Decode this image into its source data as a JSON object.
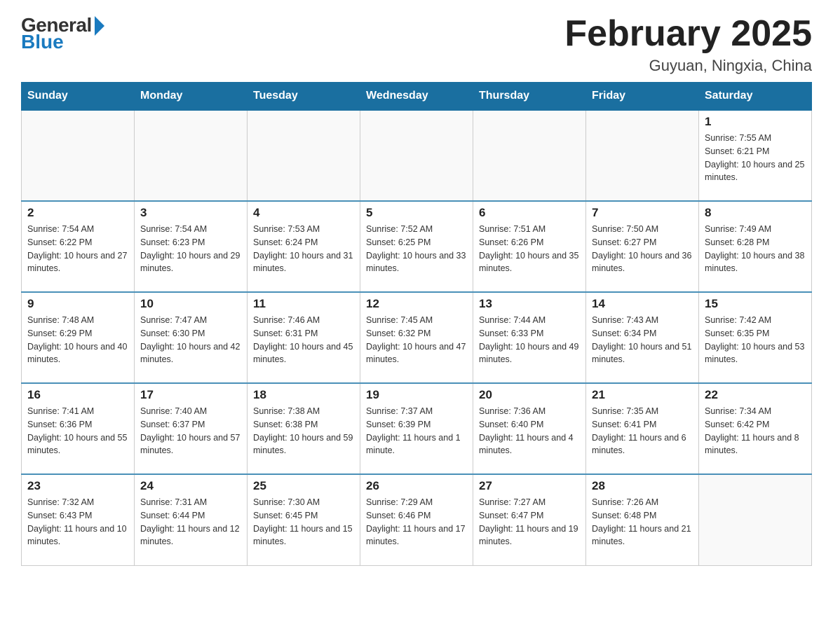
{
  "header": {
    "logo_general": "General",
    "logo_blue": "Blue",
    "month_title": "February 2025",
    "location": "Guyuan, Ningxia, China"
  },
  "weekdays": [
    "Sunday",
    "Monday",
    "Tuesday",
    "Wednesday",
    "Thursday",
    "Friday",
    "Saturday"
  ],
  "weeks": [
    [
      {
        "day": "",
        "sunrise": "",
        "sunset": "",
        "daylight": ""
      },
      {
        "day": "",
        "sunrise": "",
        "sunset": "",
        "daylight": ""
      },
      {
        "day": "",
        "sunrise": "",
        "sunset": "",
        "daylight": ""
      },
      {
        "day": "",
        "sunrise": "",
        "sunset": "",
        "daylight": ""
      },
      {
        "day": "",
        "sunrise": "",
        "sunset": "",
        "daylight": ""
      },
      {
        "day": "",
        "sunrise": "",
        "sunset": "",
        "daylight": ""
      },
      {
        "day": "1",
        "sunrise": "Sunrise: 7:55 AM",
        "sunset": "Sunset: 6:21 PM",
        "daylight": "Daylight: 10 hours and 25 minutes."
      }
    ],
    [
      {
        "day": "2",
        "sunrise": "Sunrise: 7:54 AM",
        "sunset": "Sunset: 6:22 PM",
        "daylight": "Daylight: 10 hours and 27 minutes."
      },
      {
        "day": "3",
        "sunrise": "Sunrise: 7:54 AM",
        "sunset": "Sunset: 6:23 PM",
        "daylight": "Daylight: 10 hours and 29 minutes."
      },
      {
        "day": "4",
        "sunrise": "Sunrise: 7:53 AM",
        "sunset": "Sunset: 6:24 PM",
        "daylight": "Daylight: 10 hours and 31 minutes."
      },
      {
        "day": "5",
        "sunrise": "Sunrise: 7:52 AM",
        "sunset": "Sunset: 6:25 PM",
        "daylight": "Daylight: 10 hours and 33 minutes."
      },
      {
        "day": "6",
        "sunrise": "Sunrise: 7:51 AM",
        "sunset": "Sunset: 6:26 PM",
        "daylight": "Daylight: 10 hours and 35 minutes."
      },
      {
        "day": "7",
        "sunrise": "Sunrise: 7:50 AM",
        "sunset": "Sunset: 6:27 PM",
        "daylight": "Daylight: 10 hours and 36 minutes."
      },
      {
        "day": "8",
        "sunrise": "Sunrise: 7:49 AM",
        "sunset": "Sunset: 6:28 PM",
        "daylight": "Daylight: 10 hours and 38 minutes."
      }
    ],
    [
      {
        "day": "9",
        "sunrise": "Sunrise: 7:48 AM",
        "sunset": "Sunset: 6:29 PM",
        "daylight": "Daylight: 10 hours and 40 minutes."
      },
      {
        "day": "10",
        "sunrise": "Sunrise: 7:47 AM",
        "sunset": "Sunset: 6:30 PM",
        "daylight": "Daylight: 10 hours and 42 minutes."
      },
      {
        "day": "11",
        "sunrise": "Sunrise: 7:46 AM",
        "sunset": "Sunset: 6:31 PM",
        "daylight": "Daylight: 10 hours and 45 minutes."
      },
      {
        "day": "12",
        "sunrise": "Sunrise: 7:45 AM",
        "sunset": "Sunset: 6:32 PM",
        "daylight": "Daylight: 10 hours and 47 minutes."
      },
      {
        "day": "13",
        "sunrise": "Sunrise: 7:44 AM",
        "sunset": "Sunset: 6:33 PM",
        "daylight": "Daylight: 10 hours and 49 minutes."
      },
      {
        "day": "14",
        "sunrise": "Sunrise: 7:43 AM",
        "sunset": "Sunset: 6:34 PM",
        "daylight": "Daylight: 10 hours and 51 minutes."
      },
      {
        "day": "15",
        "sunrise": "Sunrise: 7:42 AM",
        "sunset": "Sunset: 6:35 PM",
        "daylight": "Daylight: 10 hours and 53 minutes."
      }
    ],
    [
      {
        "day": "16",
        "sunrise": "Sunrise: 7:41 AM",
        "sunset": "Sunset: 6:36 PM",
        "daylight": "Daylight: 10 hours and 55 minutes."
      },
      {
        "day": "17",
        "sunrise": "Sunrise: 7:40 AM",
        "sunset": "Sunset: 6:37 PM",
        "daylight": "Daylight: 10 hours and 57 minutes."
      },
      {
        "day": "18",
        "sunrise": "Sunrise: 7:38 AM",
        "sunset": "Sunset: 6:38 PM",
        "daylight": "Daylight: 10 hours and 59 minutes."
      },
      {
        "day": "19",
        "sunrise": "Sunrise: 7:37 AM",
        "sunset": "Sunset: 6:39 PM",
        "daylight": "Daylight: 11 hours and 1 minute."
      },
      {
        "day": "20",
        "sunrise": "Sunrise: 7:36 AM",
        "sunset": "Sunset: 6:40 PM",
        "daylight": "Daylight: 11 hours and 4 minutes."
      },
      {
        "day": "21",
        "sunrise": "Sunrise: 7:35 AM",
        "sunset": "Sunset: 6:41 PM",
        "daylight": "Daylight: 11 hours and 6 minutes."
      },
      {
        "day": "22",
        "sunrise": "Sunrise: 7:34 AM",
        "sunset": "Sunset: 6:42 PM",
        "daylight": "Daylight: 11 hours and 8 minutes."
      }
    ],
    [
      {
        "day": "23",
        "sunrise": "Sunrise: 7:32 AM",
        "sunset": "Sunset: 6:43 PM",
        "daylight": "Daylight: 11 hours and 10 minutes."
      },
      {
        "day": "24",
        "sunrise": "Sunrise: 7:31 AM",
        "sunset": "Sunset: 6:44 PM",
        "daylight": "Daylight: 11 hours and 12 minutes."
      },
      {
        "day": "25",
        "sunrise": "Sunrise: 7:30 AM",
        "sunset": "Sunset: 6:45 PM",
        "daylight": "Daylight: 11 hours and 15 minutes."
      },
      {
        "day": "26",
        "sunrise": "Sunrise: 7:29 AM",
        "sunset": "Sunset: 6:46 PM",
        "daylight": "Daylight: 11 hours and 17 minutes."
      },
      {
        "day": "27",
        "sunrise": "Sunrise: 7:27 AM",
        "sunset": "Sunset: 6:47 PM",
        "daylight": "Daylight: 11 hours and 19 minutes."
      },
      {
        "day": "28",
        "sunrise": "Sunrise: 7:26 AM",
        "sunset": "Sunset: 6:48 PM",
        "daylight": "Daylight: 11 hours and 21 minutes."
      },
      {
        "day": "",
        "sunrise": "",
        "sunset": "",
        "daylight": ""
      }
    ]
  ]
}
